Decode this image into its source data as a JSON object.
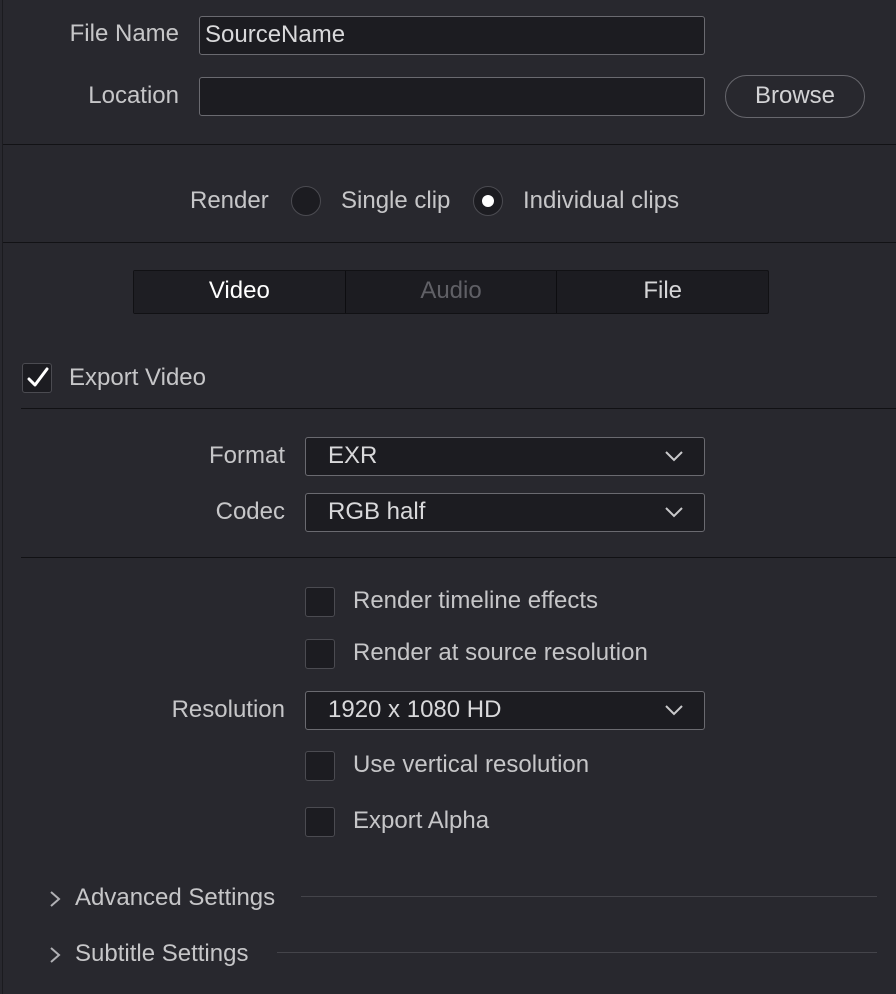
{
  "file": {
    "name_label": "File Name",
    "name_value": "SourceName",
    "location_label": "Location",
    "location_value": "",
    "browse_label": "Browse"
  },
  "render": {
    "label": "Render",
    "options": [
      {
        "label": "Single clip",
        "selected": false
      },
      {
        "label": "Individual clips",
        "selected": true
      }
    ]
  },
  "tabs": [
    {
      "label": "Video",
      "state": "active"
    },
    {
      "label": "Audio",
      "state": "disabled"
    },
    {
      "label": "File",
      "state": "normal"
    }
  ],
  "video": {
    "export_label": "Export Video",
    "export_checked": true,
    "format_label": "Format",
    "format_value": "EXR",
    "codec_label": "Codec",
    "codec_value": "RGB half",
    "render_timeline_effects": "Render timeline effects",
    "render_source_resolution": "Render at source resolution",
    "resolution_label": "Resolution",
    "resolution_value": "1920 x 1080 HD",
    "use_vertical_resolution": "Use vertical resolution",
    "export_alpha": "Export Alpha"
  },
  "sections": {
    "advanced": "Advanced Settings",
    "subtitle": "Subtitle Settings"
  },
  "icons": {
    "checkmark": "checkmark-icon",
    "chevron_down": "chevron-down-icon",
    "chevron_right": "chevron-right-icon"
  },
  "colors": {
    "background": "#28282e",
    "field": "#1c1c21",
    "text": "#c6c6c8"
  }
}
